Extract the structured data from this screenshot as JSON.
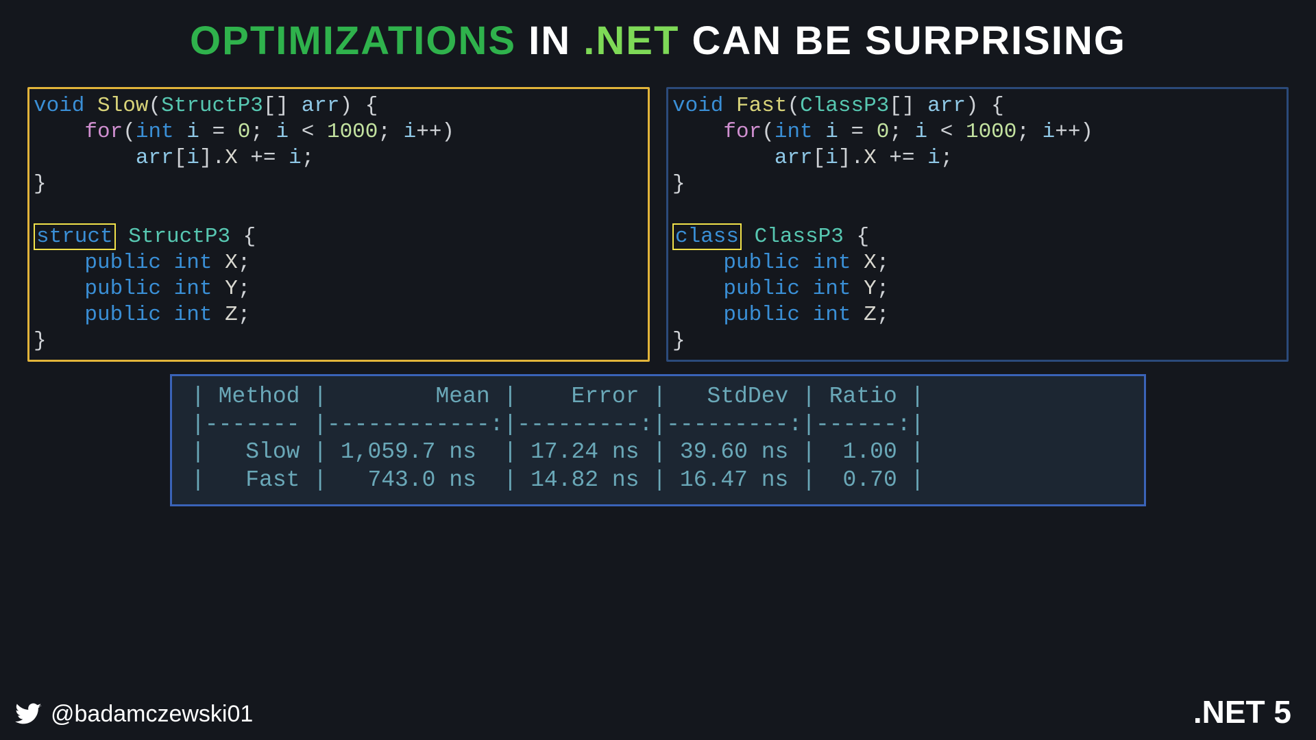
{
  "title": {
    "w1": "OPTIMIZATIONS",
    "w2": "IN",
    "w3": ".NET",
    "w4": "CAN BE SURPRISING"
  },
  "colors": {
    "left_border": "#e2b43a",
    "right_border": "#2b4a7a",
    "bench_border": "#3a63b8",
    "highlight_box": "#f2e24a",
    "title_green": "#2fb24c",
    "title_light": "#7ed957"
  },
  "code": {
    "left": {
      "fn_sig_kw": "void",
      "fn_name": "Slow",
      "param_type": "StructP3",
      "param_name": "arr",
      "for_kw": "for",
      "int_kw": "int",
      "i": "i",
      "zero": "0",
      "limit": "1000",
      "loop_body": "arr[i].X += i;",
      "type_kw": "struct",
      "type_name": "StructP3",
      "public_kw": "public",
      "field_type": "int",
      "field_x": "X",
      "field_y": "Y",
      "field_z": "Z"
    },
    "right": {
      "fn_sig_kw": "void",
      "fn_name": "Fast",
      "param_type": "ClassP3",
      "param_name": "arr",
      "for_kw": "for",
      "int_kw": "int",
      "i": "i",
      "zero": "0",
      "limit": "1000",
      "loop_body": "arr[i].X += i;",
      "type_kw": "class",
      "type_name": "ClassP3",
      "public_kw": "public",
      "field_type": "int",
      "field_x": "X",
      "field_y": "Y",
      "field_z": "Z"
    }
  },
  "benchmark": {
    "headers": [
      "Method",
      "Mean",
      "Error",
      "StdDev",
      "Ratio"
    ],
    "rows": [
      {
        "method": "Slow",
        "mean": "1,059.7 ns",
        "error": "17.24 ns",
        "stddev": "39.60 ns",
        "ratio": "1.00"
      },
      {
        "method": "Fast",
        "mean": "743.0 ns",
        "error": "14.82 ns",
        "stddev": "16.47 ns",
        "ratio": "0.70"
      }
    ],
    "text": {
      "l1": "| Method |        Mean |    Error |   StdDev | Ratio |",
      "l2": "|------- |------------:|---------:|---------:|------:|",
      "l3": "|   Slow | 1,059.7 ns  | 17.24 ns | 39.60 ns |  1.00 |",
      "l4": "|   Fast |   743.0 ns  | 14.82 ns | 16.47 ns |  0.70 |"
    }
  },
  "footer": {
    "handle": "@badamczewski01",
    "netver": ".NET 5",
    "twitter_icon": "twitter-icon"
  }
}
